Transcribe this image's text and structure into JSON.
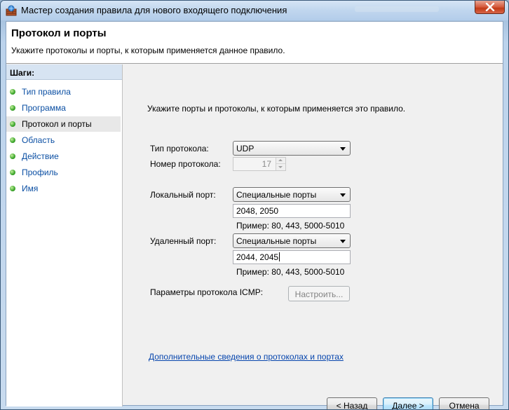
{
  "window": {
    "title": "Мастер создания правила для нового входящего подключения"
  },
  "header": {
    "title": "Протокол и порты",
    "subtitle": "Укажите протоколы и порты, к которым применяется данное правило."
  },
  "sidebar": {
    "title": "Шаги:",
    "items": [
      {
        "label": "Тип правила"
      },
      {
        "label": "Программа"
      },
      {
        "label": "Протокол и порты"
      },
      {
        "label": "Область"
      },
      {
        "label": "Действие"
      },
      {
        "label": "Профиль"
      },
      {
        "label": "Имя"
      }
    ],
    "active_index": 2
  },
  "main": {
    "instruction": "Укажите порты и протоколы, к которым применяется это правило.",
    "protocol_type": {
      "label": "Тип протокола:",
      "value": "UDP"
    },
    "protocol_number": {
      "label": "Номер протокола:",
      "value": "17"
    },
    "local_port": {
      "label": "Локальный порт:",
      "mode": "Специальные порты",
      "value": "2048, 2050",
      "example": "Пример: 80, 443, 5000-5010"
    },
    "remote_port": {
      "label": "Удаленный порт:",
      "mode": "Специальные порты",
      "value": "2044, 2045",
      "example": "Пример: 80, 443, 5000-5010"
    },
    "icmp": {
      "label": "Параметры протокола ICMP:",
      "button": "Настроить..."
    },
    "more_info_link": "Дополнительные сведения о протоколах и портах"
  },
  "footer": {
    "back": "< Назад",
    "next": "Далее >",
    "cancel": "Отмена"
  },
  "colors": {
    "link": "#0645ad",
    "step_link": "#0b4fa3",
    "close_button": "#c23b17"
  }
}
